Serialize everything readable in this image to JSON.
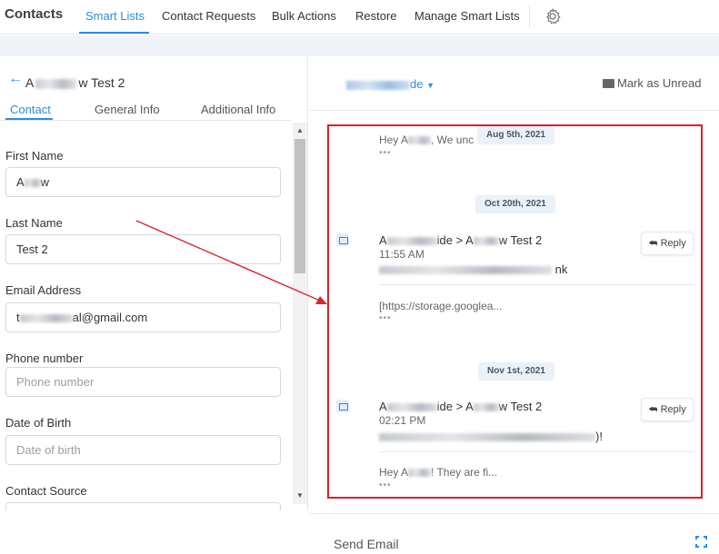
{
  "nav": {
    "brand": "Contacts",
    "tabs": [
      "Smart Lists",
      "Contact Requests",
      "Bulk Actions",
      "Restore",
      "Manage Smart Lists"
    ],
    "active_tab": "Smart Lists"
  },
  "contact": {
    "name_prefix": "A",
    "name_suffix": "w Test 2",
    "tabs": [
      "Contact",
      "General Info",
      "Additional Info"
    ],
    "active_tab": "Contact"
  },
  "form": {
    "first_name": {
      "label": "First Name",
      "value_prefix": "A",
      "value_suffix": "w"
    },
    "last_name": {
      "label": "Last Name",
      "value": "Test 2"
    },
    "email": {
      "label": "Email Address",
      "value_prefix": "t",
      "value_suffix": "al@gmail.com"
    },
    "phone": {
      "label": "Phone number",
      "placeholder": "Phone number"
    },
    "dob": {
      "label": "Date of Birth",
      "placeholder": "Date of birth"
    },
    "source": {
      "label": "Contact Source"
    }
  },
  "conversation": {
    "sender_suffix": "de",
    "mark_unread": "Mark as Unread",
    "reply_label": "Reply",
    "messages": [
      {
        "date": "Aug 5th, 2021",
        "preview_prefix": "Hey A",
        "preview_suffix": ", We unc"
      },
      {
        "date": "Oct 20th, 2021",
        "from_suffix": "ide > A",
        "to_suffix": "w Test 2",
        "time": "11:55 AM",
        "body_suffix": "nk",
        "preview": "[https://storage.googlea..."
      },
      {
        "date": "Nov 1st, 2021",
        "from_suffix": "ide > A",
        "to_suffix": "w Test 2",
        "time": "02:21 PM",
        "body_suffix": ")!",
        "preview_prefix": "Hey A",
        "preview_suffix": "! They are fi..."
      }
    ],
    "dots": "•••"
  },
  "composer": {
    "send_email": "Send Email"
  },
  "colors": {
    "accent": "#2f8be0",
    "highlight_box": "#d9202c",
    "annotation_arrow": "#e0242f"
  }
}
